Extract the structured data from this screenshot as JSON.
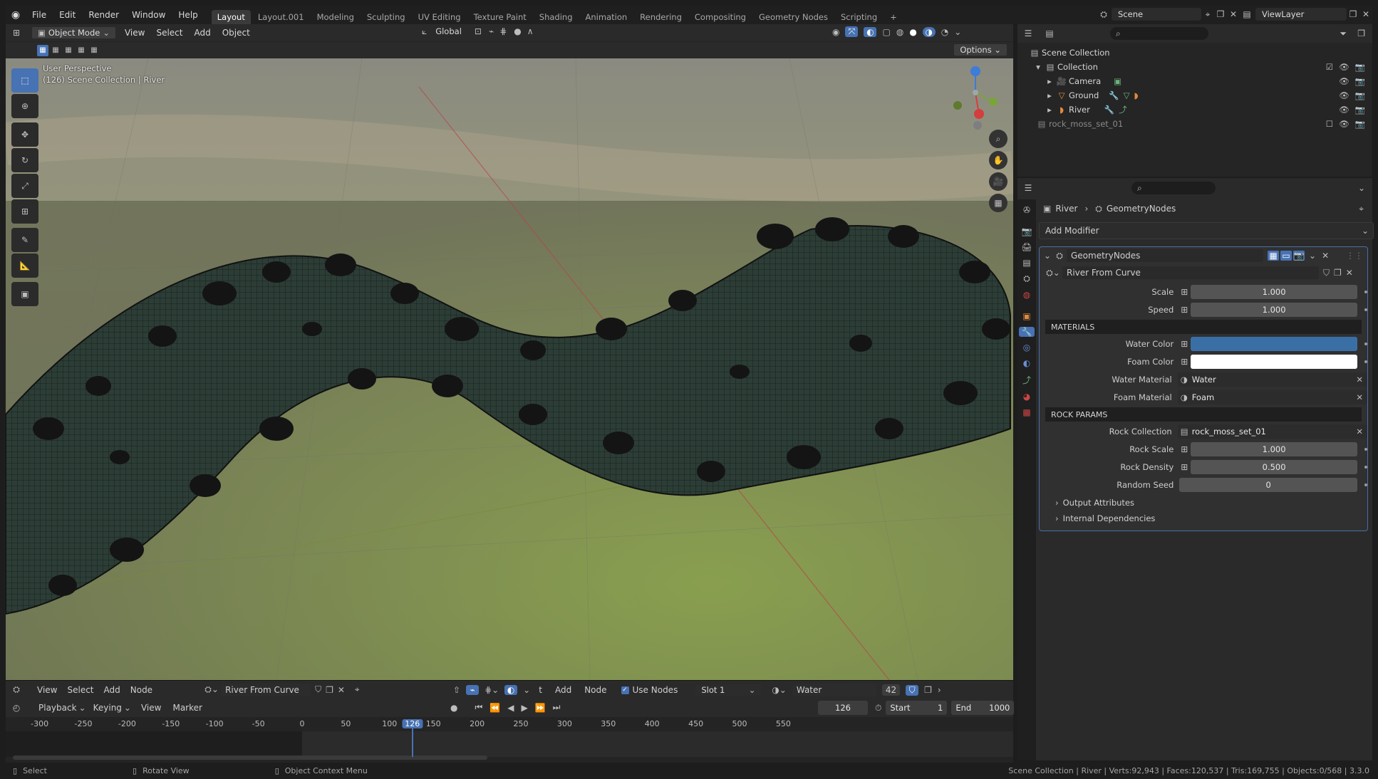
{
  "topbar": {
    "menus": [
      "File",
      "Edit",
      "Render",
      "Window",
      "Help"
    ],
    "tabs": [
      "Layout",
      "Layout.001",
      "Modeling",
      "Sculpting",
      "UV Editing",
      "Texture Paint",
      "Shading",
      "Animation",
      "Rendering",
      "Compositing",
      "Geometry Nodes",
      "Scripting"
    ],
    "active_tab": "Layout",
    "scene": "Scene",
    "view_layer": "ViewLayer"
  },
  "viewport": {
    "mode": "Object Mode",
    "menus": [
      "View",
      "Select",
      "Add",
      "Object"
    ],
    "orientation": "Global",
    "options": "Options",
    "overlay_line1": "User Perspective",
    "overlay_line2": "(126) Scene Collection | River"
  },
  "outliner": {
    "root": "Scene Collection",
    "collection": "Collection",
    "items": [
      "Camera",
      "Ground",
      "River"
    ],
    "extra": "rock_moss_set_01"
  },
  "properties": {
    "breadcrumb_obj": "River",
    "breadcrumb_mod": "GeometryNodes",
    "add_modifier": "Add Modifier",
    "modifier_name": "GeometryNodes",
    "node_group": "River From Curve",
    "params": {
      "scale_label": "Scale",
      "scale_value": "1.000",
      "speed_label": "Speed",
      "speed_value": "1.000",
      "materials_header": "MATERIALS",
      "water_color_label": "Water Color",
      "foam_color_label": "Foam Color",
      "water_material_label": "Water Material",
      "water_material": "Water",
      "foam_material_label": "Foam Material",
      "foam_material": "Foam",
      "rock_header": "ROCK PARAMS",
      "rock_collection_label": "Rock Collection",
      "rock_collection": "rock_moss_set_01",
      "rock_scale_label": "Rock Scale",
      "rock_scale": "1.000",
      "rock_density_label": "Rock Density",
      "rock_density": "0.500",
      "random_seed_label": "Random Seed",
      "random_seed": "0",
      "output_attrs": "Output Attributes",
      "internal_deps": "Internal Dependencies"
    },
    "colors": {
      "water": "#3a6fa6",
      "foam": "#ffffff"
    }
  },
  "node_header": {
    "menus": [
      "View",
      "Select",
      "Add",
      "Node"
    ],
    "tree_name": "River From Curve",
    "t_label": "t",
    "add": "Add",
    "node": "Node",
    "use_nodes": "Use Nodes",
    "slot": "Slot 1",
    "material": "Water",
    "users": "42"
  },
  "timeline": {
    "menus": [
      "Playback",
      "Keying",
      "View",
      "Marker"
    ],
    "current_frame": "126",
    "start_label": "Start",
    "start": "1",
    "end_label": "End",
    "end": "1000",
    "ticks": [
      "-300",
      "-250",
      "-200",
      "-150",
      "-100",
      "-50",
      "0",
      "50",
      "100",
      "126",
      "150",
      "200",
      "250",
      "300",
      "350",
      "400",
      "450",
      "500",
      "550"
    ]
  },
  "statusbar": {
    "select": "Select",
    "rotate": "Rotate View",
    "context": "Object Context Menu",
    "stats": "Scene Collection | River | Verts:92,943 | Faces:120,537 | Tris:169,755 | Objects:0/568 | 3.3.0"
  }
}
